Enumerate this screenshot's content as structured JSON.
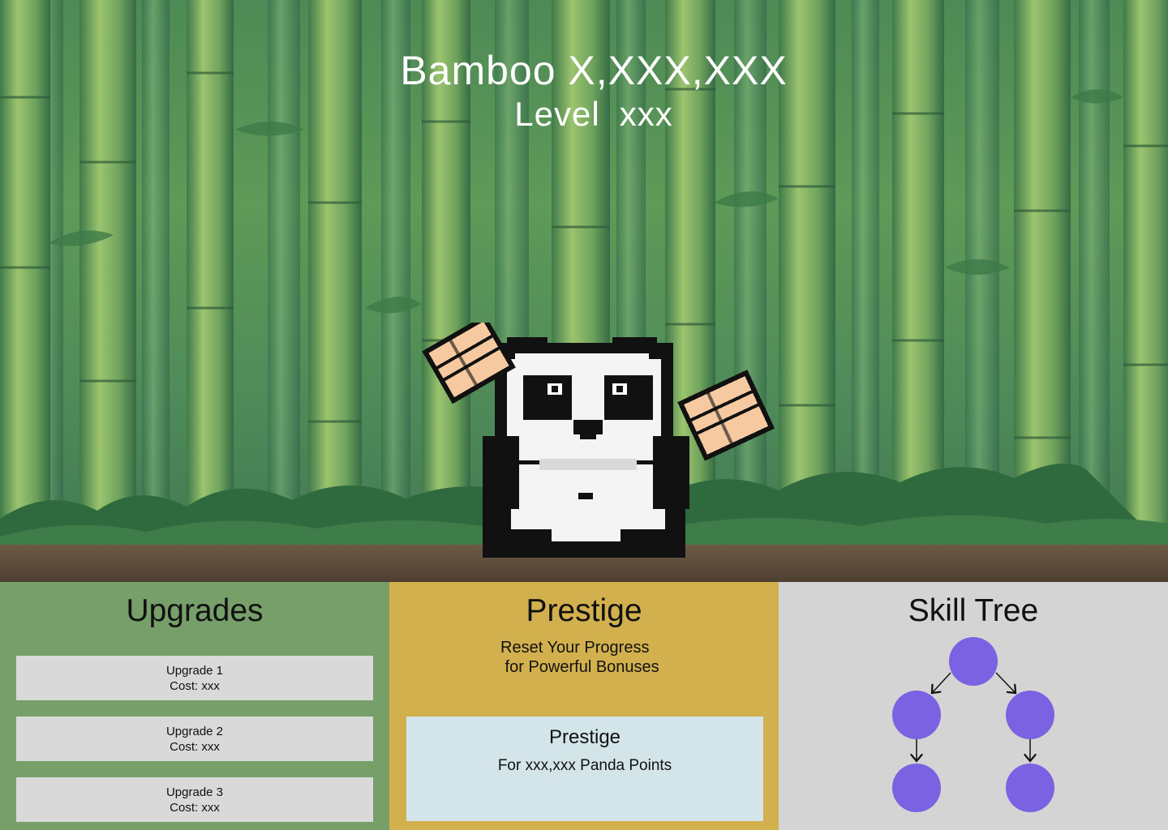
{
  "hud": {
    "bamboo": "Bamboo X,XXX,XXX",
    "level_label": "Level",
    "level_value": "xxx"
  },
  "panda": {
    "icon": "panda-fighter-icon"
  },
  "upgrades": {
    "title": "Upgrades",
    "items": [
      {
        "name": "Upgrade 1",
        "cost": "Cost: xxx"
      },
      {
        "name": "Upgrade 2",
        "cost": "Cost: xxx"
      },
      {
        "name": "Upgrade 3",
        "cost": "Cost: xxx"
      }
    ]
  },
  "prestige": {
    "title": "Prestige",
    "description_line1": "Reset Your Progress",
    "description_line2": " for Powerful Bonuses",
    "button_title": "Prestige",
    "button_subtitle": "For xxx,xxx Panda Points"
  },
  "skill_tree": {
    "title": "Skill Tree",
    "node_color": "#7b62e2"
  },
  "colors": {
    "upgrades_bg": "#769f6a",
    "prestige_bg": "#d3b04e",
    "prestige_button_bg": "#d4e5ea",
    "skill_tree_bg": "#d4d4d4",
    "card_bg": "#d9d9d9"
  }
}
